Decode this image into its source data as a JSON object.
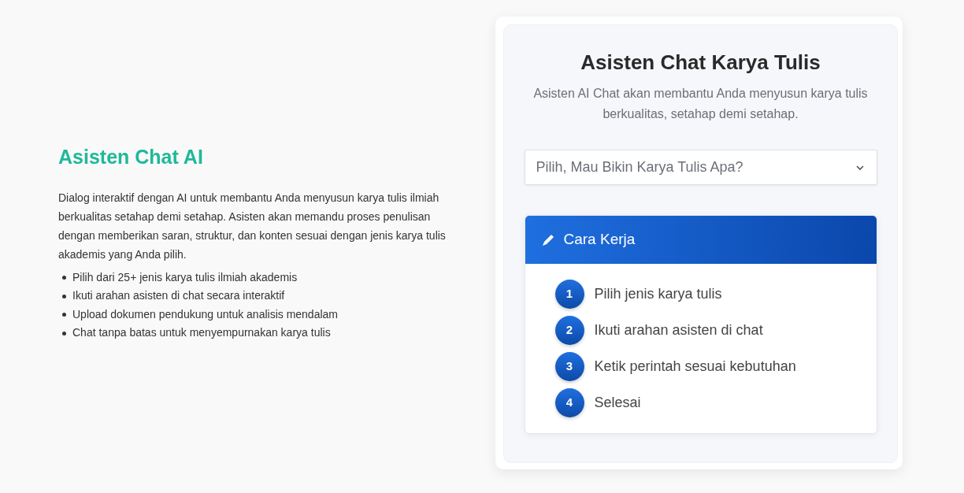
{
  "intro": {
    "title": "Asisten Chat AI",
    "description": "Dialog interaktif dengan AI untuk membantu Anda menyusun karya tulis ilmiah berkualitas setahap demi setahap. Asisten akan memandu proses penulisan dengan memberikan saran, struktur, dan konten sesuai dengan jenis karya tulis akademis yang Anda pilih.",
    "features": [
      "Pilih dari 25+ jenis karya tulis ilmiah akademis",
      "Ikuti arahan asisten di chat secara interaktif",
      "Upload dokumen pendukung untuk analisis mendalam",
      "Chat tanpa batas untuk menyempurnakan karya tulis"
    ]
  },
  "card": {
    "title": "Asisten Chat Karya Tulis",
    "subtitle": "Asisten AI Chat akan membantu Anda menyusun karya tulis berkualitas, setahap demi setahap.",
    "select": {
      "placeholder": "Pilih, Mau Bikin Karya Tulis Apa?"
    },
    "how_it_works": {
      "title": "Cara Kerja",
      "steps": [
        {
          "number": "1",
          "label": "Pilih jenis karya tulis"
        },
        {
          "number": "2",
          "label": "Ikuti arahan asisten di chat"
        },
        {
          "number": "3",
          "label": "Ketik perintah sesuai kebutuhan"
        },
        {
          "number": "4",
          "label": "Selesai"
        }
      ]
    }
  }
}
